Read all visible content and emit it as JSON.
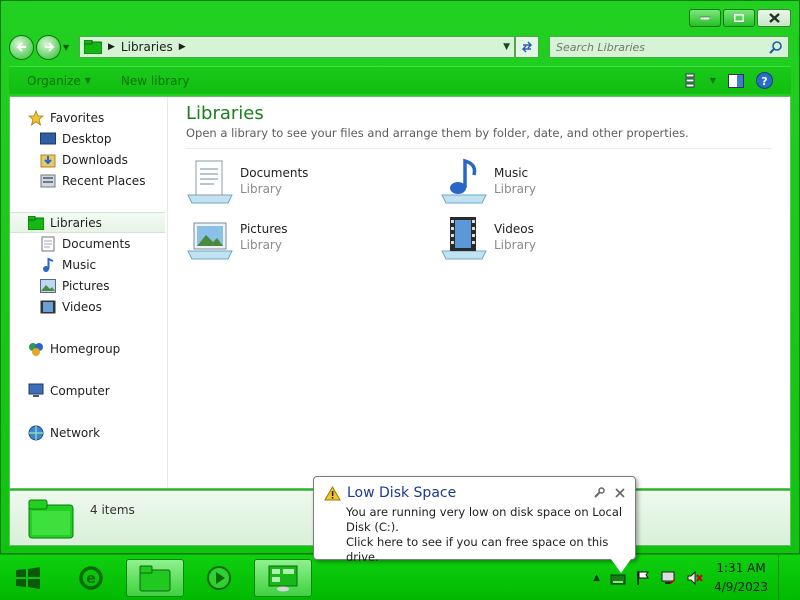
{
  "window": {
    "controls": {
      "minimize": "minimize-icon",
      "maximize": "maximize-icon",
      "close": "close-icon"
    }
  },
  "navbar": {
    "address_crumbs": [
      "Libraries"
    ],
    "search_placeholder": "Search Libraries"
  },
  "toolbar": {
    "organize_label": "Organize",
    "new_library_label": "New library"
  },
  "sidebar": {
    "favorites": {
      "label": "Favorites",
      "items": [
        "Desktop",
        "Downloads",
        "Recent Places"
      ]
    },
    "libraries": {
      "label": "Libraries",
      "items": [
        "Documents",
        "Music",
        "Pictures",
        "Videos"
      ]
    },
    "homegroup": "Homegroup",
    "computer": "Computer",
    "network": "Network"
  },
  "main": {
    "title": "Libraries",
    "description": "Open a library to see your files and arrange them by folder, date, and other properties.",
    "libraries": [
      {
        "name": "Documents",
        "type": "Library",
        "icon": "documents-library-icon"
      },
      {
        "name": "Music",
        "type": "Library",
        "icon": "music-library-icon"
      },
      {
        "name": "Pictures",
        "type": "Library",
        "icon": "pictures-library-icon"
      },
      {
        "name": "Videos",
        "type": "Library",
        "icon": "videos-library-icon"
      }
    ]
  },
  "details": {
    "count": "4 items"
  },
  "notification": {
    "title": "Low Disk Space",
    "line1": "You are running very low on disk space on Local Disk (C:).",
    "line2": "Click here to see if you can free space on this drive."
  },
  "taskbar": {
    "time": "1:31 AM",
    "date": "4/9/2023"
  },
  "colors": {
    "accent": "#19c919",
    "title_blue": "#1a7f1a",
    "balloon_title": "#1a3a8f"
  }
}
